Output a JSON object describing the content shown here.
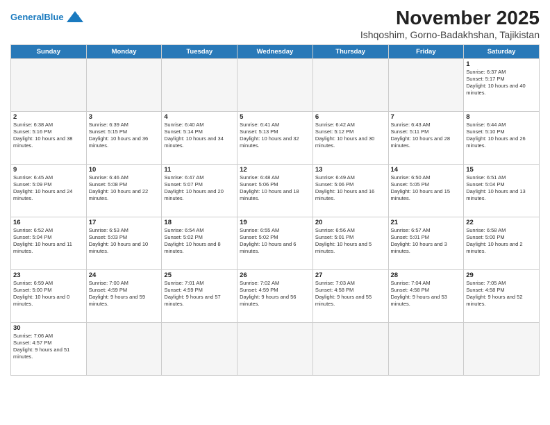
{
  "header": {
    "logo_general": "General",
    "logo_blue": "Blue",
    "month_title": "November 2025",
    "location": "Ishqoshim, Gorno-Badakhshan, Tajikistan"
  },
  "days_of_week": [
    "Sunday",
    "Monday",
    "Tuesday",
    "Wednesday",
    "Thursday",
    "Friday",
    "Saturday"
  ],
  "weeks": [
    [
      {
        "day": "",
        "empty": true
      },
      {
        "day": "",
        "empty": true
      },
      {
        "day": "",
        "empty": true
      },
      {
        "day": "",
        "empty": true
      },
      {
        "day": "",
        "empty": true
      },
      {
        "day": "",
        "empty": true
      },
      {
        "day": "1",
        "sunrise": "6:37 AM",
        "sunset": "5:17 PM",
        "daylight": "10 hours and 40 minutes."
      }
    ],
    [
      {
        "day": "2",
        "sunrise": "6:38 AM",
        "sunset": "5:16 PM",
        "daylight": "10 hours and 38 minutes."
      },
      {
        "day": "3",
        "sunrise": "6:39 AM",
        "sunset": "5:15 PM",
        "daylight": "10 hours and 36 minutes."
      },
      {
        "day": "4",
        "sunrise": "6:40 AM",
        "sunset": "5:14 PM",
        "daylight": "10 hours and 34 minutes."
      },
      {
        "day": "5",
        "sunrise": "6:41 AM",
        "sunset": "5:13 PM",
        "daylight": "10 hours and 32 minutes."
      },
      {
        "day": "6",
        "sunrise": "6:42 AM",
        "sunset": "5:12 PM",
        "daylight": "10 hours and 30 minutes."
      },
      {
        "day": "7",
        "sunrise": "6:43 AM",
        "sunset": "5:11 PM",
        "daylight": "10 hours and 28 minutes."
      },
      {
        "day": "8",
        "sunrise": "6:44 AM",
        "sunset": "5:10 PM",
        "daylight": "10 hours and 26 minutes."
      }
    ],
    [
      {
        "day": "9",
        "sunrise": "6:45 AM",
        "sunset": "5:09 PM",
        "daylight": "10 hours and 24 minutes."
      },
      {
        "day": "10",
        "sunrise": "6:46 AM",
        "sunset": "5:08 PM",
        "daylight": "10 hours and 22 minutes."
      },
      {
        "day": "11",
        "sunrise": "6:47 AM",
        "sunset": "5:07 PM",
        "daylight": "10 hours and 20 minutes."
      },
      {
        "day": "12",
        "sunrise": "6:48 AM",
        "sunset": "5:06 PM",
        "daylight": "10 hours and 18 minutes."
      },
      {
        "day": "13",
        "sunrise": "6:49 AM",
        "sunset": "5:06 PM",
        "daylight": "10 hours and 16 minutes."
      },
      {
        "day": "14",
        "sunrise": "6:50 AM",
        "sunset": "5:05 PM",
        "daylight": "10 hours and 15 minutes."
      },
      {
        "day": "15",
        "sunrise": "6:51 AM",
        "sunset": "5:04 PM",
        "daylight": "10 hours and 13 minutes."
      }
    ],
    [
      {
        "day": "16",
        "sunrise": "6:52 AM",
        "sunset": "5:04 PM",
        "daylight": "10 hours and 11 minutes."
      },
      {
        "day": "17",
        "sunrise": "6:53 AM",
        "sunset": "5:03 PM",
        "daylight": "10 hours and 10 minutes."
      },
      {
        "day": "18",
        "sunrise": "6:54 AM",
        "sunset": "5:02 PM",
        "daylight": "10 hours and 8 minutes."
      },
      {
        "day": "19",
        "sunrise": "6:55 AM",
        "sunset": "5:02 PM",
        "daylight": "10 hours and 6 minutes."
      },
      {
        "day": "20",
        "sunrise": "6:56 AM",
        "sunset": "5:01 PM",
        "daylight": "10 hours and 5 minutes."
      },
      {
        "day": "21",
        "sunrise": "6:57 AM",
        "sunset": "5:01 PM",
        "daylight": "10 hours and 3 minutes."
      },
      {
        "day": "22",
        "sunrise": "6:58 AM",
        "sunset": "5:00 PM",
        "daylight": "10 hours and 2 minutes."
      }
    ],
    [
      {
        "day": "23",
        "sunrise": "6:59 AM",
        "sunset": "5:00 PM",
        "daylight": "10 hours and 0 minutes."
      },
      {
        "day": "24",
        "sunrise": "7:00 AM",
        "sunset": "4:59 PM",
        "daylight": "9 hours and 59 minutes."
      },
      {
        "day": "25",
        "sunrise": "7:01 AM",
        "sunset": "4:59 PM",
        "daylight": "9 hours and 57 minutes."
      },
      {
        "day": "26",
        "sunrise": "7:02 AM",
        "sunset": "4:59 PM",
        "daylight": "9 hours and 56 minutes."
      },
      {
        "day": "27",
        "sunrise": "7:03 AM",
        "sunset": "4:58 PM",
        "daylight": "9 hours and 55 minutes."
      },
      {
        "day": "28",
        "sunrise": "7:04 AM",
        "sunset": "4:58 PM",
        "daylight": "9 hours and 53 minutes."
      },
      {
        "day": "29",
        "sunrise": "7:05 AM",
        "sunset": "4:58 PM",
        "daylight": "9 hours and 52 minutes."
      }
    ],
    [
      {
        "day": "30",
        "sunrise": "7:06 AM",
        "sunset": "4:57 PM",
        "daylight": "9 hours and 51 minutes."
      },
      {
        "day": "",
        "empty": true
      },
      {
        "day": "",
        "empty": true
      },
      {
        "day": "",
        "empty": true
      },
      {
        "day": "",
        "empty": true
      },
      {
        "day": "",
        "empty": true
      },
      {
        "day": "",
        "empty": true
      }
    ]
  ]
}
